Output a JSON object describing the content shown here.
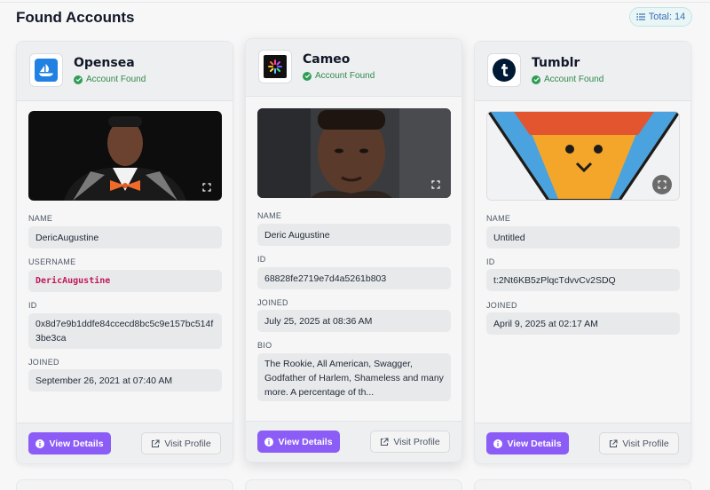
{
  "page": {
    "title": "Found Accounts",
    "total_label": "Total: 14"
  },
  "cards": [
    {
      "site": "Opensea",
      "status": "Account Found",
      "fields": [
        {
          "label": "NAME",
          "value": "DericAugustine"
        },
        {
          "label": "USERNAME",
          "value": "DericAugustine"
        },
        {
          "label": "ID",
          "value": "0x8d7e9b1ddfe84ccecd8bc5c9e157bc514f3be3ca"
        },
        {
          "label": "JOINED",
          "value": "September 26, 2021 at 07:40 AM"
        }
      ],
      "view_label": "View Details",
      "visit_label": "Visit Profile"
    },
    {
      "site": "Cameo",
      "status": "Account Found",
      "fields": [
        {
          "label": "NAME",
          "value": "Deric Augustine"
        },
        {
          "label": "ID",
          "value": "68828fe2719e7d4a5261b803"
        },
        {
          "label": "JOINED",
          "value": "July 25, 2025 at 08:36 AM"
        },
        {
          "label": "BIO",
          "value": "The Rookie, All American, Swagger, Godfather of Harlem, Shameless and many more. A percentage of th..."
        }
      ],
      "view_label": "View Details",
      "visit_label": "Visit Profile"
    },
    {
      "site": "Tumblr",
      "status": "Account Found",
      "fields": [
        {
          "label": "NAME",
          "value": "Untitled"
        },
        {
          "label": "ID",
          "value": "t:2Nt6KB5zPlqcTdvvCv2SDQ"
        },
        {
          "label": "JOINED",
          "value": "April 9, 2025 at 02:17 AM"
        }
      ],
      "view_label": "View Details",
      "visit_label": "Visit Profile"
    }
  ],
  "colors": {
    "accent": "#8b5cf6",
    "found": "#2f9e55",
    "username": "#c2185b"
  }
}
